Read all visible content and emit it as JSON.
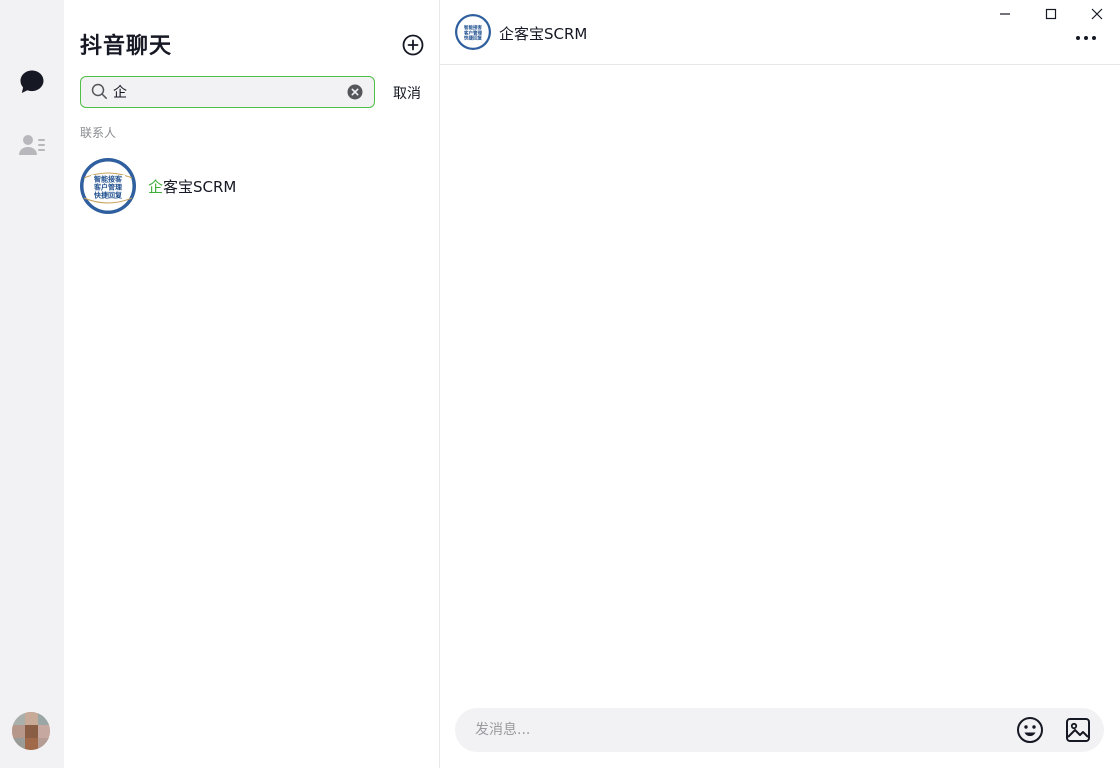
{
  "rail": {
    "icons": [
      "chat-bubble-icon",
      "contacts-icon"
    ]
  },
  "panel": {
    "title": "抖音聊天",
    "search": {
      "value": "企",
      "placeholder": ""
    },
    "cancel_label": "取消",
    "section_label": "联系人",
    "contacts": [
      {
        "name_highlight": "企",
        "name_rest": "客宝SCRM",
        "avatar_lines": [
          "智能接客",
          "客户管理",
          "快捷回复"
        ]
      }
    ]
  },
  "chat": {
    "title": "企客宝SCRM",
    "composer": {
      "placeholder": "发消息..."
    }
  },
  "colors": {
    "accent": "#3fae3a",
    "search_border": "#4fbf48",
    "rail_bg": "#f2f2f4"
  }
}
